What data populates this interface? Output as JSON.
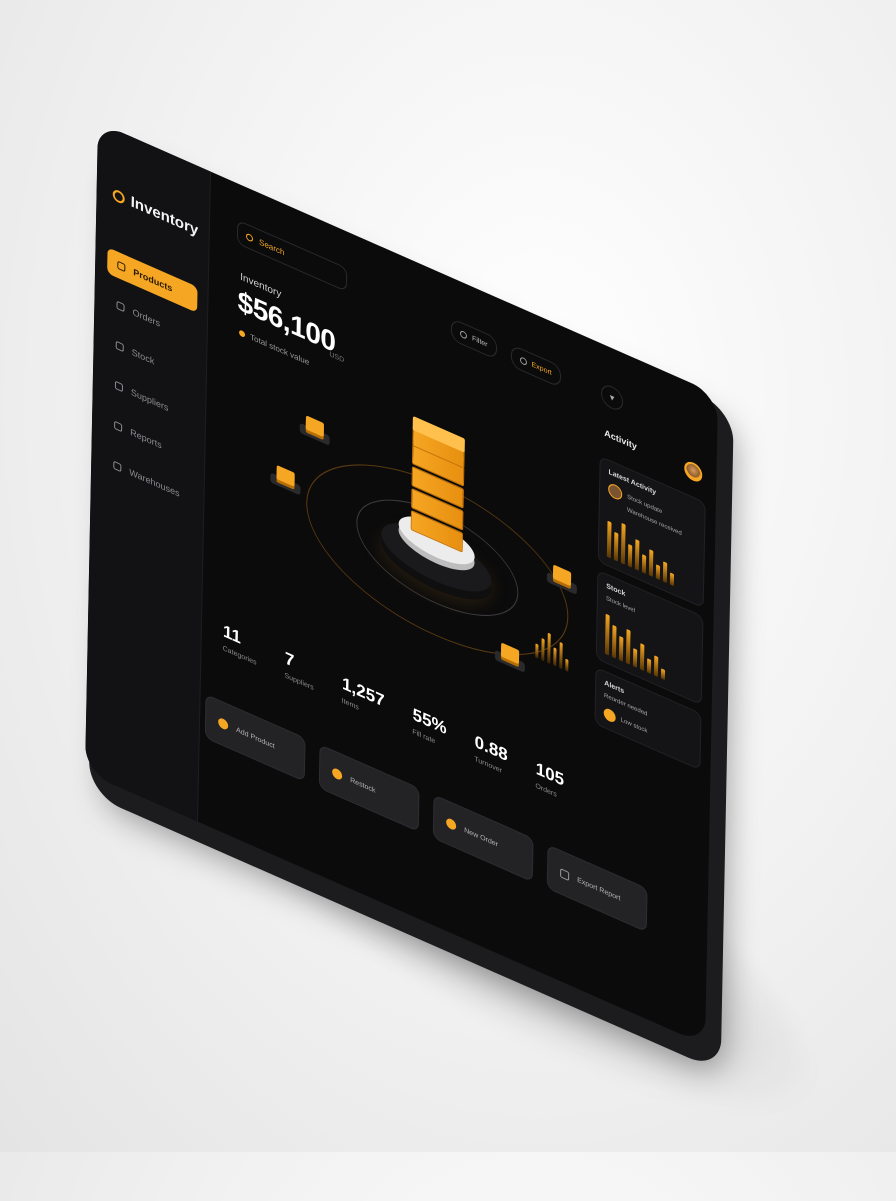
{
  "app": {
    "name": "Inventory"
  },
  "sidebar": {
    "items": [
      {
        "label": "Products",
        "active": true
      },
      {
        "label": "Orders"
      },
      {
        "label": "Stock"
      },
      {
        "label": "Suppliers"
      },
      {
        "label": "Reports"
      },
      {
        "label": "Warehouses"
      }
    ]
  },
  "search": {
    "placeholder": "Search"
  },
  "summary": {
    "label": "Inventory",
    "value": "$56,100",
    "sub": "Total stock value"
  },
  "header": {
    "buttons": [
      "Filter",
      "Export"
    ],
    "units": "USD"
  },
  "stats": [
    {
      "value": "11",
      "label": "Categories"
    },
    {
      "value": "7",
      "label": "Suppliers"
    },
    {
      "value": "1,257",
      "label": "Items"
    },
    {
      "value": "55%",
      "label": "Fill rate"
    },
    {
      "value": "0.88",
      "label": "Turnover"
    },
    {
      "value": "105",
      "label": "Orders"
    }
  ],
  "bottom_buttons": [
    "Add Product",
    "Restock",
    "New Order",
    "Export Report"
  ],
  "right": {
    "title": "Activity",
    "card1": {
      "title": "Latest Activity",
      "name": "Stock update",
      "detail": "Warehouse received"
    },
    "card2": {
      "title": "Stock",
      "label": "Stock level"
    },
    "card3": {
      "title": "Alerts",
      "sub": "Reorder needed",
      "item": "Low stock"
    }
  },
  "colors": {
    "accent": "#f5a623",
    "background": "#0b0b0c"
  }
}
